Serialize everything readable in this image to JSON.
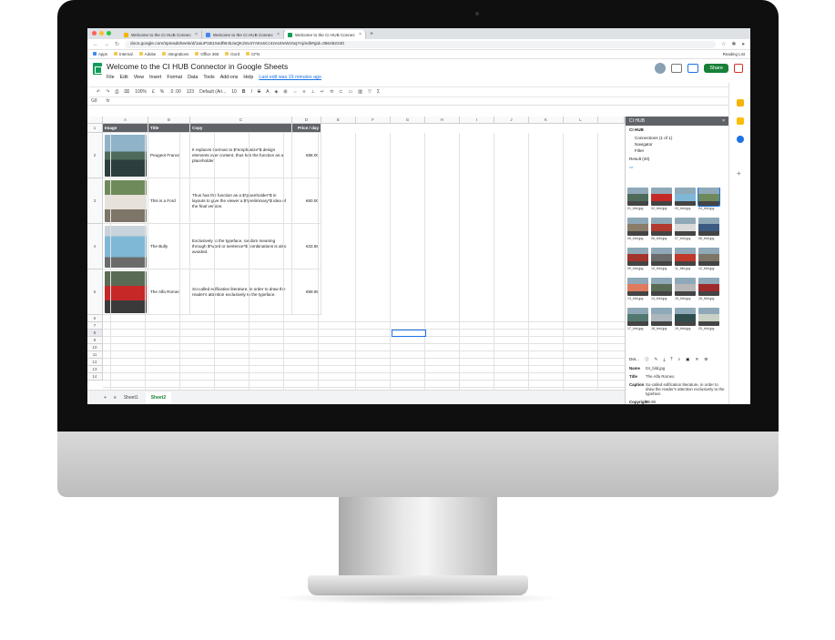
{
  "browser": {
    "tabs": [
      {
        "label": "Welcome to the CI HUB Connec"
      },
      {
        "label": "Welcome to the CI HUB Connec"
      },
      {
        "label": "Welcome to the CI HUB Connec"
      }
    ],
    "url": "docs.google.com/spreadsheets/d/1aiuP1B1Xedf5HbJuQK2Sv47AKssCc4zeU0vWcNq7Aj/edit#gid=366462240",
    "bookmarks": [
      "Apps",
      "Internal",
      "Adobe",
      "Integrations",
      "Office 365",
      "Gord",
      "CFN"
    ],
    "reading_list": "Reading List"
  },
  "sheets": {
    "title": "Welcome to the CI HUB Connector in Google Sheets",
    "menus": [
      "File",
      "Edit",
      "View",
      "Insert",
      "Format",
      "Data",
      "Tools",
      "Add-ons",
      "Help"
    ],
    "last_edit": "Last edit was 19 minutes ago",
    "share_label": "Share",
    "toolbar": {
      "zoom": "100%",
      "currency": "£",
      "percent": "%",
      "decimals": ".0  .00",
      "format": "123",
      "font": "Default (Ari...",
      "size": "10"
    },
    "cell_ref": "G8",
    "fx": "fx",
    "columns": [
      "A",
      "B",
      "C",
      "D",
      "E",
      "F",
      "G",
      "H",
      "I",
      "J",
      "K",
      "L"
    ],
    "header_row": [
      "Image",
      "Title",
      "Copy",
      "Price / day"
    ],
    "rows": [
      {
        "num": "2",
        "title": "Peugeot France",
        "copy": "It replaces German to $*emphasize*$ design elements over content, thus has the function as a placeholder.",
        "price": "€88.00"
      },
      {
        "num": "3",
        "title": "This is a Ford",
        "copy": "Thus has the function as a $*placeholder*$ in layouts to give the viewer a $*preliminary*$ idea of the final version.",
        "price": "€60.00"
      },
      {
        "num": "4",
        "title": "The Bully",
        "copy": "Exclusively to the typeface, random meaning through $*word or sentence*$ combinations is also avoided.",
        "price": "€33.88"
      },
      {
        "num": "5",
        "title": "The Alfa Romeo",
        "copy": "So-called edification literature, in order to draw the reader's attention exclusively to the typeface.",
        "price": "€99.99"
      }
    ],
    "empty_rows": [
      "1",
      "6",
      "7",
      "8",
      "9",
      "10",
      "11",
      "12",
      "13",
      "14"
    ],
    "sheet_tabs": [
      "Sheet1",
      "Sheet2"
    ],
    "colors": {
      "green": "#188038",
      "header_bg": "#5f6368"
    }
  },
  "panel": {
    "title": "CI HUB",
    "hub_label": "CI HUB",
    "connections": "Connections  (1 of 1)",
    "navigator": "Navigator",
    "filter": "Filter",
    "result": "Result (20)",
    "thumbs": [
      "01_bild.jpg",
      "02_bild.jpg",
      "03_bild.jpg",
      "04_bild.jpg",
      "05_bild.jpg",
      "06_bild.jpg",
      "07_bild.jpg",
      "08_bild.jpg",
      "09_bild.jpg",
      "10_bild.jpg",
      "11_bild.jpg",
      "12_bild.jpg",
      "13_bild.jpg",
      "14_bild.jpg",
      "15_bild.jpg",
      "16_bild.jpg",
      "17_bild.jpg",
      "18_bild.jpg",
      "19_bild.jpg",
      "20_bild.jpg"
    ],
    "details_label": "Det...",
    "meta": {
      "name_k": "Name",
      "name_v": "04_bild.jpg",
      "title_k": "Title",
      "title_v": "The Alfa Romeo",
      "caption_k": "Caption",
      "caption_v": "So-called edification literature, in order to draw the reader's attention exclusively to the typeface",
      "copyright_k": "Copyright",
      "copyright_v": "99.99"
    }
  }
}
